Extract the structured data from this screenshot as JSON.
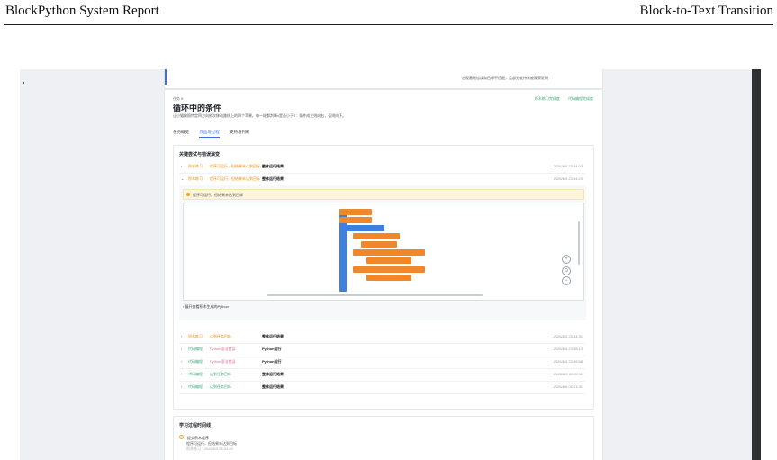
{
  "header": {
    "left": "BlockPython System Report",
    "right": "Block-to-Text Transition"
  },
  "top_card": {
    "note": "出现基础错误和目标不匹配，且部分支持未被观察证明"
  },
  "task": {
    "label": "任务 8",
    "title": "循环中的条件",
    "description": "让小猫按照特定四方向依次移动路线上的四个苹果。每一轮都判断x是否小于2：条件成立则向右，否则向下。",
    "links": [
      "积木练习完成度",
      "代码编程完成度"
    ],
    "tabs": [
      {
        "label": "任务概览",
        "active": false
      },
      {
        "label": "作品与过程",
        "active": true
      },
      {
        "label": "支持与判断",
        "active": false
      }
    ]
  },
  "attempts": {
    "title": "关键尝试与错误演变",
    "rows": [
      {
        "chev": "›",
        "tag1": "积木练习",
        "tag2": "程序可运行，但结果未达到目标",
        "result": "整体运行结果",
        "time": "2026/6/5 23:54:03",
        "style": "orange"
      },
      {
        "chev": "⌄",
        "tag1": "积木练习",
        "tag2": "程序可运行，但结果未达到目标",
        "result": "整体运行结果",
        "time": "2026/6/5 23:54:23",
        "style": "orange"
      },
      {
        "chev": "›",
        "tag1": "积木练习",
        "tag2": "达到任务目标",
        "result": "整体运行结果",
        "time": "2026/6/5 23:54:31",
        "style": "green"
      },
      {
        "chev": "›",
        "tag1": "代码编程",
        "tag2": "Python语法错误",
        "result": "Python运行",
        "time": "2026/6/5 23:58:13",
        "style": "pyth"
      },
      {
        "chev": "›",
        "tag1": "代码编程",
        "tag2": "Python语法错误",
        "result": "Python运行",
        "time": "2026/6/5 23:59:58",
        "style": "pyth"
      },
      {
        "chev": "›",
        "tag1": "代码编程",
        "tag2": "达到任务目标",
        "result": "整体运行结果",
        "time": "2026/6/6 00:00:11",
        "style": "green"
      },
      {
        "chev": "›",
        "tag1": "代码编程",
        "tag2": "达到任务目标",
        "result": "整体运行结果",
        "time": "2026/6/6 00:01:31",
        "style": "green"
      }
    ],
    "warning": "程序可运行，但结果未达到目标",
    "python_toggle": "展开查看积木生成的Python",
    "zoom": {
      "in": "+",
      "reset": "⊙",
      "out": "−"
    },
    "blocks": {
      "move": "移",
      "step": "步",
      "repeat": "重复执行",
      "times": "次",
      "if": "如果",
      "else": "否则",
      "x": "x",
      "up": "上",
      "right": "右",
      "down": "下"
    }
  },
  "learning": {
    "title": "学习过程时间线",
    "event": "提交积木程序",
    "detail": "程序可运行，但结果未达到目标",
    "meta": "积木练习 · 2026/6/5 23:54:03"
  },
  "colors": {
    "accent": "#3b6df0",
    "orange_block": "#f0872a",
    "blue_block": "#3f7fe0",
    "success": "#3aa676",
    "warning": "#f3a51b"
  }
}
